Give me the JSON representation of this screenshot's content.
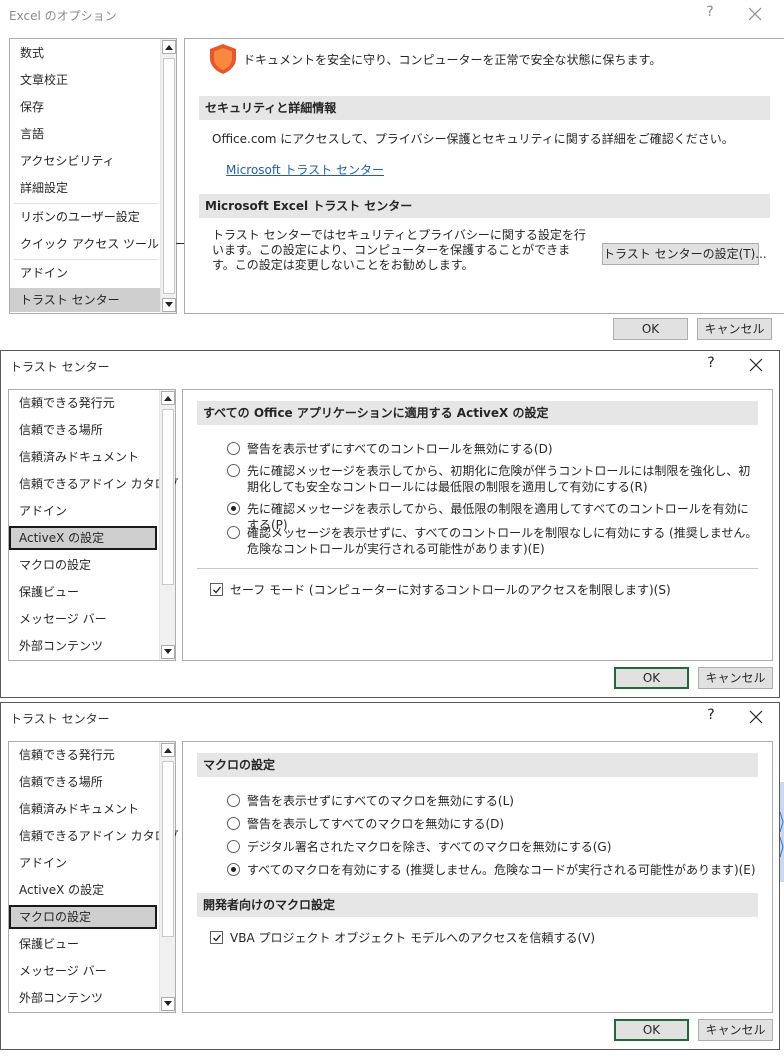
{
  "dialog1": {
    "title": "Excel のオプション",
    "help": "?",
    "nav": [
      {
        "label": "数式"
      },
      {
        "label": "文章校正"
      },
      {
        "label": "保存"
      },
      {
        "label": "言語"
      },
      {
        "label": "アクセシビリティ"
      },
      {
        "label": "詳細設定"
      },
      {
        "label": "リボンのユーザー設定"
      },
      {
        "label": "クイック アクセス ツール バー"
      },
      {
        "label": "アドイン"
      },
      {
        "label": "トラスト センター"
      }
    ],
    "header_text": "ドキュメントを安全に守り、コンピューターを正常で安全な状態に保ちます。",
    "section1_title": "セキュリティと詳細情報",
    "section1_text": "Office.com にアクセスして、プライバシー保護とセキュリティに関する詳細をご確認ください。",
    "section1_link": "Microsoft トラスト センター",
    "section2_title": "Microsoft Excel トラスト センター",
    "section2_text": "トラスト センターではセキュリティとプライバシーに関する設定を行います。この設定により、コンピューターを保護することができます。この設定は変更しないことをお勧めします。",
    "trust_button": "トラスト センターの設定(T)...",
    "ok": "OK",
    "cancel": "キャンセル"
  },
  "dialog2": {
    "title": "トラスト センター",
    "help": "?",
    "nav": [
      {
        "label": "信頼できる発行元"
      },
      {
        "label": "信頼できる場所"
      },
      {
        "label": "信頼済みドキュメント"
      },
      {
        "label": "信頼できるアドイン カタログ"
      },
      {
        "label": "アドイン"
      },
      {
        "label": "ActiveX の設定"
      },
      {
        "label": "マクロの設定"
      },
      {
        "label": "保護ビュー"
      },
      {
        "label": "メッセージ バー"
      },
      {
        "label": "外部コンテンツ"
      }
    ],
    "section_title": "すべての Office アプリケーションに適用する ActiveX の設定",
    "options": [
      {
        "label": "警告を表示せずにすべてのコントロールを無効にする(D)"
      },
      {
        "label": "先に確認メッセージを表示してから、初期化に危険が伴うコントロールには制限を強化し、初期化しても安全なコントロールには最低限の制限を適用して有効にする(R)"
      },
      {
        "label": "先に確認メッセージを表示してから、最低限の制限を適用してすべてのコントロールを有効にする(P)"
      },
      {
        "label": "確認メッセージを表示せずに、すべてのコントロールを制限なしに有効にする (推奨しません。危険なコントロールが実行される可能性があります)(E)"
      }
    ],
    "safe_mode": "セーフ モード (コンピューターに対するコントロールのアクセスを制限します)(S)",
    "ok": "OK",
    "cancel": "キャンセル"
  },
  "dialog3": {
    "title": "トラスト センター",
    "help": "?",
    "nav": [
      {
        "label": "信頼できる発行元"
      },
      {
        "label": "信頼できる場所"
      },
      {
        "label": "信頼済みドキュメント"
      },
      {
        "label": "信頼できるアドイン カタログ"
      },
      {
        "label": "アドイン"
      },
      {
        "label": "ActiveX の設定"
      },
      {
        "label": "マクロの設定"
      },
      {
        "label": "保護ビュー"
      },
      {
        "label": "メッセージ バー"
      },
      {
        "label": "外部コンテンツ"
      }
    ],
    "section1_title": "マクロの設定",
    "options": [
      {
        "label": "警告を表示せずにすべてのマクロを無効にする(L)"
      },
      {
        "label": "警告を表示してすべてのマクロを無効にする(D)"
      },
      {
        "label": "デジタル署名されたマクロを除き、すべてのマクロを無効にする(G)"
      },
      {
        "label": "すべてのマクロを有効にする (推奨しません。危険なコードが実行される可能性があります)(E)"
      }
    ],
    "section2_title": "開発者向けのマクロ設定",
    "vba_label": "VBA プロジェクト オブジェクト モデルへのアクセスを信頼する(V)",
    "ok": "OK",
    "cancel": "キャンセル"
  }
}
